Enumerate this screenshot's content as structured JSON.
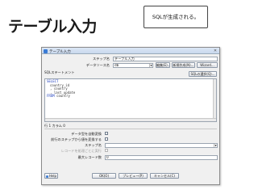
{
  "slide": {
    "title": "テーブル入力",
    "callout": "SQLが生成される。"
  },
  "dialog": {
    "window_title": "テーブル入力",
    "step_name_label": "ステップ名",
    "step_name_value": "テーブル入力",
    "datasource_label": "データソース名",
    "datasource_value": "db",
    "edit_button": "編集(E)...",
    "new_button": "新規作成(N)...",
    "wizard_button": "Wizard...",
    "sql_label": "SQLステートメント",
    "get_sql_button": "SQLの選択(Q)...",
    "sql_lines": {
      "select": "SELECT",
      "col1": "country_id",
      "col2": ", country",
      "col3": ", last_update",
      "from_kw": "FROM",
      "from_table": "country"
    },
    "position_label": "行 1 カラム 0",
    "lazy_conversion_label": "データ型を自動変換",
    "replace_variables_label": "前行のステップから値を変換する",
    "insert_from_step_label": "ステップ名",
    "execute_each_row_label": "レコードを処理ごとに実行",
    "limit_label": "最大レコード数",
    "limit_value": "0",
    "help_button": "Help",
    "ok_button": "OK(O)",
    "preview_button": "プレビュー(P)",
    "cancel_button": "キャンセル(C)"
  },
  "colors": {
    "sql_keyword": "#1f3fbf",
    "titlebar": "#c9d8ee"
  }
}
